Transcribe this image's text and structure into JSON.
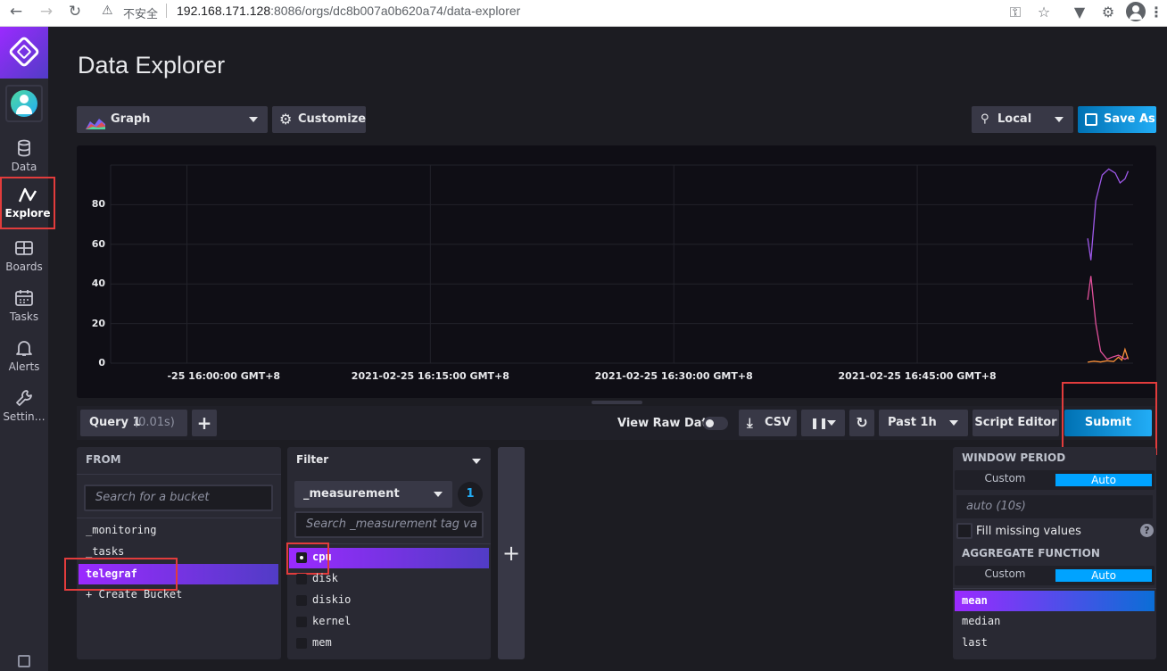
{
  "browser": {
    "insecure_label": "不安全",
    "url_host": "192.168.171.128",
    "url_rest": ":8086/orgs/dc8b007a0b620a74/data-explorer"
  },
  "sidebar": {
    "items": [
      {
        "label": "Data",
        "icon": "database-icon"
      },
      {
        "label": "Explore",
        "icon": "explore-icon"
      },
      {
        "label": "Boards",
        "icon": "boards-icon"
      },
      {
        "label": "Tasks",
        "icon": "calendar-icon"
      },
      {
        "label": "Alerts",
        "icon": "bell-icon"
      },
      {
        "label": "Settin…",
        "icon": "wrench-icon"
      }
    ]
  },
  "page": {
    "title": "Data Explorer"
  },
  "toolbar": {
    "vis_type": "Graph",
    "customize_label": "Customize",
    "timezone": "Local",
    "save_as_label": "Save As"
  },
  "chart_data": {
    "type": "line",
    "title": "",
    "xlabel": "",
    "ylabel": "",
    "ylim": [
      0,
      100
    ],
    "y_ticks": [
      "0",
      "20",
      "40",
      "60",
      "80"
    ],
    "x_tick_labels": [
      "2021-02-25 16:00:00 GMT+8",
      "2021-02-25 16:15:00 GMT+8",
      "2021-02-25 16:30:00 GMT+8",
      "2021-02-25 16:45:00 GMT+8"
    ],
    "x_tick_labels_visible": [
      "-25 16:00:00 GMT+8",
      "2021-02-25 16:15:00 GMT+8",
      "2021-02-25 16:30:00 GMT+8",
      "2021-02-25 16:45:00 GMT+8"
    ],
    "x_range_minutes": [
      -4.7,
      58.3
    ],
    "grid": true,
    "series": [
      {
        "color": "#9d58e8",
        "x_minutes": [
          55.5,
          55.7,
          56.0,
          56.4,
          56.8,
          57.2,
          57.5,
          57.8,
          58.0
        ],
        "values": [
          63,
          52,
          82,
          95,
          98,
          96,
          91,
          93,
          97
        ]
      },
      {
        "color": "#e0509a",
        "x_minutes": [
          55.5,
          55.7,
          56.0,
          56.3,
          56.7,
          57.0,
          57.4,
          57.8,
          58.0
        ],
        "values": [
          32,
          44,
          20,
          6,
          2,
          3,
          4,
          2,
          3
        ]
      },
      {
        "color": "#f98f39",
        "x_minutes": [
          55.5,
          55.9,
          56.3,
          56.7,
          57.1,
          57.4,
          57.6,
          57.8,
          58.0
        ],
        "values": [
          0.5,
          1,
          0.6,
          1.2,
          0.8,
          3,
          1.5,
          7,
          2
        ]
      }
    ]
  },
  "query": {
    "tab_label": "Query 1",
    "tab_time": "(0.01s)",
    "add_label": "+",
    "view_raw_label": "View Raw Data",
    "csv_label": "CSV",
    "time_range": "Past 1h",
    "script_editor_label": "Script Editor",
    "submit_label": "Submit"
  },
  "from_panel": {
    "header": "FROM",
    "search_placeholder": "Search for a bucket",
    "buckets": [
      "_monitoring",
      "_tasks",
      "telegraf"
    ],
    "selected": "telegraf",
    "create_label": "+ Create Bucket"
  },
  "filter_panel": {
    "header": "Filter",
    "key": "_measurement",
    "count": "1",
    "search_placeholder": "Search _measurement tag va",
    "values": [
      "cpu",
      "disk",
      "diskio",
      "kernel",
      "mem"
    ],
    "selected": "cpu"
  },
  "add_filter_label": "+",
  "window_panel": {
    "header": "WINDOW PERIOD",
    "custom_label": "Custom",
    "auto_label": "Auto",
    "period_placeholder": "auto (10s)",
    "fill_label": "Fill missing values",
    "help_label": "?"
  },
  "aggregate_panel": {
    "header": "AGGREGATE FUNCTION",
    "custom_label": "Custom",
    "auto_label": "Auto",
    "functions": [
      "mean",
      "median",
      "last"
    ],
    "selected": "mean"
  }
}
